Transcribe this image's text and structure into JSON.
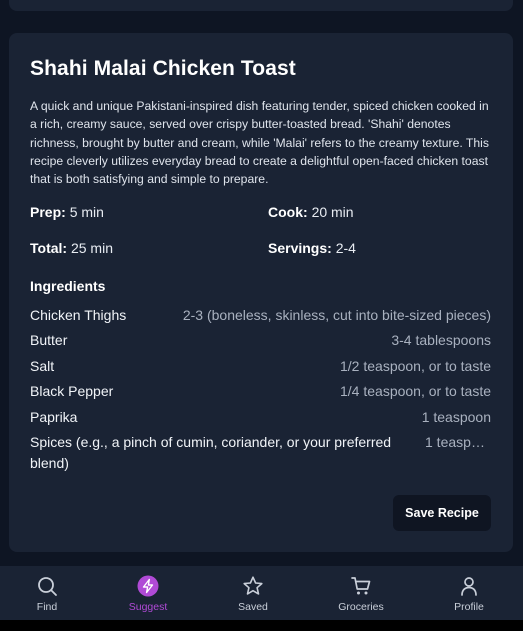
{
  "recipe": {
    "title": "Shahi Malai Chicken Toast",
    "description": "A quick and unique Pakistani-inspired dish featuring tender, spiced chicken cooked in a rich, creamy sauce, served over crispy butter-toasted bread. 'Shahi' denotes richness, brought by butter and cream, while 'Malai' refers to the creamy texture. This recipe cleverly utilizes everyday bread to create a delightful open-faced chicken toast that is both satisfying and simple to prepare.",
    "prep_label": "Prep:",
    "prep_value": "5 min",
    "cook_label": "Cook:",
    "cook_value": "20 min",
    "total_label": "Total:",
    "total_value": "25 min",
    "servings_label": "Servings:",
    "servings_value": "2-4",
    "ingredients_heading": "Ingredients",
    "ingredients": [
      {
        "name": "Chicken Thighs",
        "qty": "2-3 (boneless, skinless, cut into bite-sized pieces)"
      },
      {
        "name": "Butter",
        "qty": "3-4 tablespoons"
      },
      {
        "name": "Salt",
        "qty": "1/2 teaspoon, or to taste"
      },
      {
        "name": "Black Pepper",
        "qty": "1/4 teaspoon, or to taste"
      },
      {
        "name": "Paprika",
        "qty": "1 teaspoon"
      },
      {
        "name": "Spices (e.g., a pinch of cumin, coriander, or your preferred blend)",
        "qty": "1 teaspo…"
      }
    ],
    "save_label": "Save Recipe"
  },
  "nav": {
    "items": [
      {
        "label": "Find",
        "icon": "search-icon"
      },
      {
        "label": "Suggest",
        "icon": "lightning-icon",
        "active": true
      },
      {
        "label": "Saved",
        "icon": "star-icon"
      },
      {
        "label": "Groceries",
        "icon": "cart-icon"
      },
      {
        "label": "Profile",
        "icon": "person-icon"
      }
    ]
  },
  "colors": {
    "background": "#0e1523",
    "card": "#1a2334",
    "accent": "#b04ad6",
    "muted_text": "#a9b1bf"
  }
}
